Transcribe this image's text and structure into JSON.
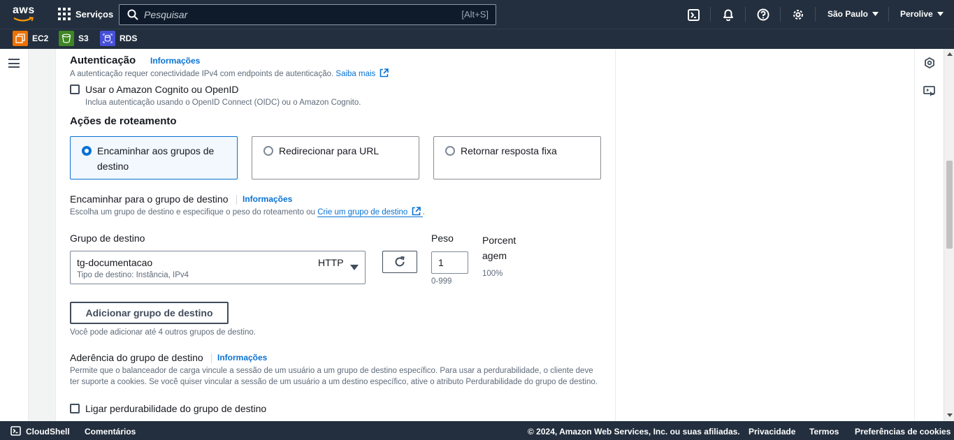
{
  "topnav": {
    "logo_text": "aws",
    "services_label": "Serviços",
    "search_placeholder": "Pesquisar",
    "search_shortcut": "[Alt+S]",
    "region_label": "São Paulo",
    "account_label": "Perolive",
    "icons": [
      "cloudshell-icon",
      "bell-icon",
      "help-icon",
      "gear-icon"
    ]
  },
  "favorites": [
    {
      "label": "EC2",
      "icon": "ec2-icon",
      "color": "#ed7100"
    },
    {
      "label": "S3",
      "icon": "s3-icon",
      "color": "#3f8624"
    },
    {
      "label": "RDS",
      "icon": "rds-icon",
      "color": "#4650d8"
    }
  ],
  "auth": {
    "title": "Autenticação",
    "info": "Informações",
    "description": "A autenticação requer conectividade IPv4 com endpoints de autenticação.",
    "learn_more": "Saiba mais",
    "checkbox_label": "Usar o Amazon Cognito ou OpenID",
    "checkbox_checked": false,
    "checkbox_desc": "Inclua autenticação usando o OpenID Connect (OIDC) ou o Amazon Cognito."
  },
  "routing": {
    "title": "Ações de roteamento",
    "options": [
      {
        "label": "Encaminhar aos grupos de destino",
        "selected": true
      },
      {
        "label": "Redirecionar para URL",
        "selected": false
      },
      {
        "label": "Retornar resposta fixa",
        "selected": false
      }
    ]
  },
  "forward": {
    "title": "Encaminhar para o grupo de destino",
    "info": "Informações",
    "description": "Escolha um grupo de destino e especifique o peso do roteamento ou",
    "create_link": "Crie um grupo de destino",
    "col_group": "Grupo de destino",
    "col_weight": "Peso",
    "col_percent": "Porcentagem",
    "selected_group": "tg-documentacao",
    "selected_group_desc": "Tipo de destino: Instância, IPv4",
    "protocol": "HTTP",
    "weight_value": "1",
    "weight_hint": "0-999",
    "percent_value": "100%",
    "add_button": "Adicionar grupo de destino",
    "add_hint": "Você pode adicionar até 4 outros grupos de destino."
  },
  "stickiness": {
    "title": "Aderência do grupo de destino",
    "info": "Informações",
    "description": "Permite que o balanceador de carga vincule a sessão de um usuário a um grupo de destino específico. Para usar a perdurabilidade, o cliente deve ter suporte a cookies. Se você quiser vincular a sessão de um usuário a um destino específico, ative o atributo Perdurabilidade do grupo de destino.",
    "checkbox_label": "Ligar perdurabilidade do grupo de destino",
    "checkbox_checked": false
  },
  "footer": {
    "cloudshell": "CloudShell",
    "feedback": "Comentários",
    "copyright": "© 2024, Amazon Web Services, Inc. ou suas afiliadas.",
    "privacy": "Privacidade",
    "terms": "Termos",
    "cookies": "Preferências de cookies"
  },
  "colors": {
    "nav_bg": "#232f3e",
    "link": "#0972d3",
    "selected_card_bg": "#f2f8fd"
  }
}
